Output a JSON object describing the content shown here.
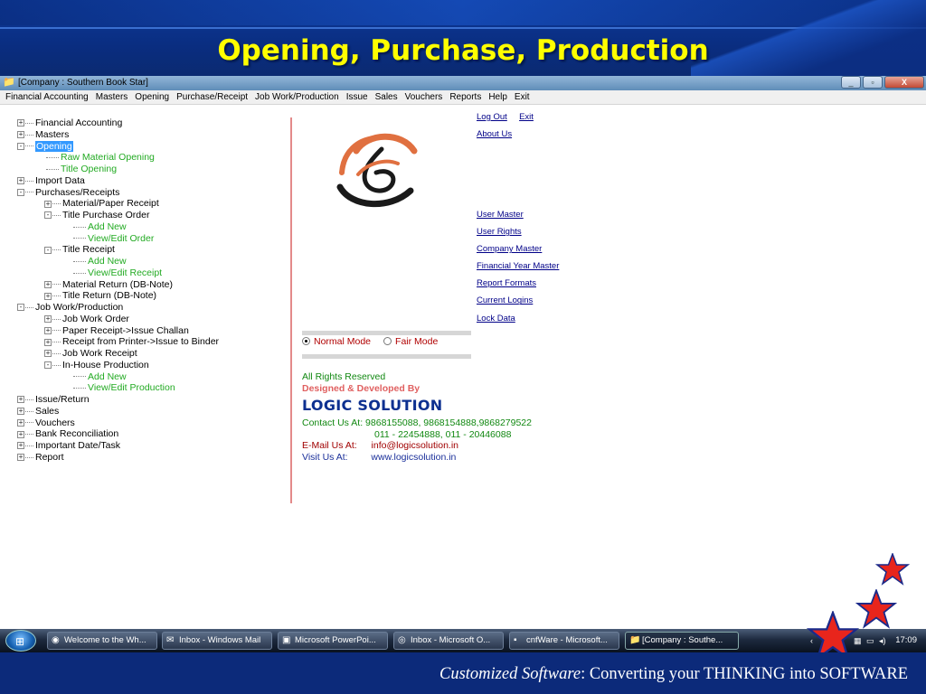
{
  "slide": {
    "title": "Opening, Purchase, Production",
    "footer_italic": "Customized Software",
    "footer_rest": ":   Converting your THINKING into SOFTWARE"
  },
  "window": {
    "title": "[Company : Southern Book Star]",
    "controls": [
      "_",
      "▫",
      "X"
    ]
  },
  "menu": [
    "Financial Accounting",
    "Masters",
    "Opening",
    "Purchase/Receipt",
    "Job Work/Production",
    "Issue",
    "Sales",
    "Vouchers",
    "Reports",
    "Help",
    "Exit"
  ],
  "tree": [
    {
      "label": "Financial Accounting",
      "level": 0,
      "toggle": "+"
    },
    {
      "label": "Masters",
      "level": 0,
      "toggle": "+"
    },
    {
      "label": "Opening",
      "level": 0,
      "toggle": "-",
      "selected": true
    },
    {
      "label": "Raw Material Opening",
      "level": 1,
      "leaf": true
    },
    {
      "label": "Title Opening",
      "level": 1,
      "leaf": true
    },
    {
      "label": "Import Data",
      "level": 0,
      "toggle": "+"
    },
    {
      "label": "Purchases/Receipts",
      "level": 0,
      "toggle": "-"
    },
    {
      "label": "Material/Paper Receipt",
      "level": 1,
      "toggle": "+"
    },
    {
      "label": "Title Purchase Order",
      "level": 1,
      "toggle": "-"
    },
    {
      "label": "Add New",
      "level": 2,
      "leaf": true
    },
    {
      "label": "View/Edit Order",
      "level": 2,
      "leaf": true
    },
    {
      "label": "Title Receipt",
      "level": 1,
      "toggle": "-"
    },
    {
      "label": "Add New",
      "level": 2,
      "leaf": true
    },
    {
      "label": "View/Edit Receipt",
      "level": 2,
      "leaf": true
    },
    {
      "label": "Material Return (DB-Note)",
      "level": 1,
      "toggle": "+"
    },
    {
      "label": "Title Return (DB-Note)",
      "level": 1,
      "toggle": "+"
    },
    {
      "label": "Job Work/Production",
      "level": 0,
      "toggle": "-"
    },
    {
      "label": "Job Work Order",
      "level": 1,
      "toggle": "+"
    },
    {
      "label": "Paper Receipt->Issue Challan",
      "level": 1,
      "toggle": "+"
    },
    {
      "label": "Receipt from Printer->Issue to Binder",
      "level": 1,
      "toggle": "+"
    },
    {
      "label": "Job Work Receipt",
      "level": 1,
      "toggle": "+"
    },
    {
      "label": "In-House Production",
      "level": 1,
      "toggle": "-"
    },
    {
      "label": "Add New",
      "level": 2,
      "leaf": true
    },
    {
      "label": "View/Edit Production",
      "level": 2,
      "leaf": true
    },
    {
      "label": "Issue/Return",
      "level": 0,
      "toggle": "+"
    },
    {
      "label": "Sales",
      "level": 0,
      "toggle": "+"
    },
    {
      "label": "Vouchers",
      "level": 0,
      "toggle": "+"
    },
    {
      "label": "Bank Reconciliation",
      "level": 0,
      "toggle": "+"
    },
    {
      "label": "Important Date/Task",
      "level": 0,
      "toggle": "+"
    },
    {
      "label": "Report",
      "level": 0,
      "toggle": "+"
    }
  ],
  "top_links": {
    "logout": "Log Out",
    "exit": "Exit",
    "about": "About Us"
  },
  "admin_links": [
    "User Master",
    "User Rights",
    "Company Master",
    "Financial Year Master",
    "Report Formats",
    "Current Logins",
    "Lock Data"
  ],
  "modes": {
    "normal": "Normal Mode",
    "fair": "Fair Mode",
    "selected": "normal"
  },
  "info": {
    "rights": "All Rights Reserved",
    "designed": "Designed & Developed By",
    "company": "LOGIC SOLUTION",
    "contact_label": "Contact Us At:",
    "contact_1": "9868155088, 9868154888,9868279522",
    "contact_2": "011 - 22454888, 011 - 20446088",
    "email_label": "E-Mail Us At:",
    "email": "info@logicsolution.in",
    "visit_label": "Visit Us At:",
    "website": "www.logicsolution.in"
  },
  "taskbar": {
    "items": [
      {
        "label": "Welcome to the Wh...",
        "icon": "chrome-icon"
      },
      {
        "label": "Inbox - Windows Mail",
        "icon": "mail-icon"
      },
      {
        "label": "Microsoft PowerPoi...",
        "icon": "powerpoint-icon"
      },
      {
        "label": "Inbox - Microsoft O...",
        "icon": "outlook-icon"
      },
      {
        "label": "cnfWare - Microsoft...",
        "icon": "app-icon"
      },
      {
        "label": "[Company : Southe...",
        "icon": "app-icon",
        "active": true
      }
    ],
    "clock": "17:09"
  },
  "colors": {
    "title_yellow": "#ffff00",
    "star_red": "#e8251c",
    "tree_green": "#22aa22",
    "select_blue": "#3399ff"
  }
}
